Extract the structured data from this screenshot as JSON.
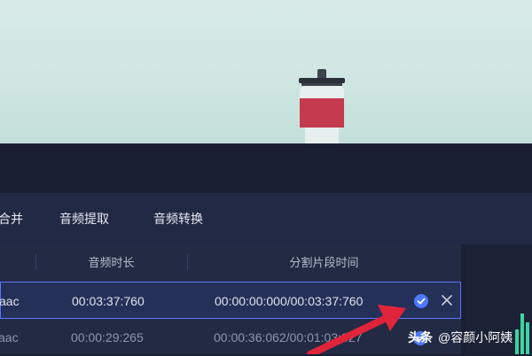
{
  "tabs": [
    {
      "label": "合并"
    },
    {
      "label": "音频提取"
    },
    {
      "label": "音频转换"
    }
  ],
  "table": {
    "columns": [
      "音频时长",
      "分割片段时间"
    ],
    "rows": [
      {
        "name": "aac",
        "duration": "00:03:37:760",
        "segment": "00:00:00:000/00:03:37:760",
        "selected": true
      },
      {
        "name": "aac",
        "duration": "00:00:29:265",
        "segment": "00:00:36:062/00:01:03:327",
        "selected": false
      }
    ]
  },
  "watermark": {
    "brand": "头条",
    "handle": "@容颜小阿姨"
  },
  "colors": {
    "accent": "#4d78ff",
    "annotation": "#e0243a",
    "visualizer": "#3cd4a0"
  }
}
